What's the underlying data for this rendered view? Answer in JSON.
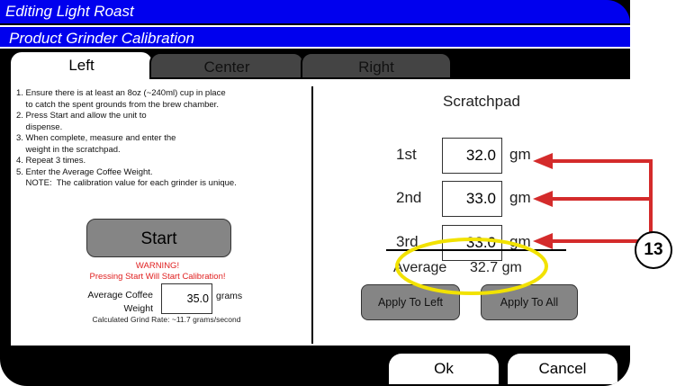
{
  "window": {
    "title": "Editing Light Roast",
    "subtitle": "Product Grinder Calibration"
  },
  "tabs": [
    {
      "label": "Left",
      "active": true
    },
    {
      "label": "Center",
      "active": false
    },
    {
      "label": "Right",
      "active": false
    }
  ],
  "instructions": [
    "1. Ensure there is at least an 8oz (~240ml) cup in place",
    "    to catch the spent grounds from the brew chamber.",
    "2. Press Start and allow the unit to",
    "    dispense.",
    "3. When complete, measure and enter the",
    "    weight in the scratchpad.",
    "4. Repeat 3 times.",
    "5. Enter the Average Coffee Weight.",
    "    NOTE:  The calibration value for each grinder is unique."
  ],
  "start_button": "Start",
  "warning": {
    "line1": "WARNING!",
    "line2": "Pressing Start Will Start Calibration!"
  },
  "average_weight": {
    "label": "Average Coffee Weight",
    "value": "35.0",
    "unit": "grams"
  },
  "grind_rate": "Calculated Grind Rate: ~11.7 grams/second",
  "scratchpad": {
    "title": "Scratchpad",
    "rows": [
      {
        "label": "1st",
        "value": "32.0",
        "unit": "gm"
      },
      {
        "label": "2nd",
        "value": "33.0",
        "unit": "gm"
      },
      {
        "label": "3rd",
        "value": "33.0",
        "unit": "gm"
      }
    ],
    "average_label": "Average",
    "average_value": "32.7  gm",
    "apply_left": "Apply To Left",
    "apply_all": "Apply To All"
  },
  "footer": {
    "ok": "Ok",
    "cancel": "Cancel"
  },
  "annotation": {
    "callout": "13",
    "arrow_color": "#d42b2b",
    "highlight_color": "#f2e200"
  },
  "colors": {
    "title_bar": "#0000ee",
    "button_gray": "#858585"
  }
}
